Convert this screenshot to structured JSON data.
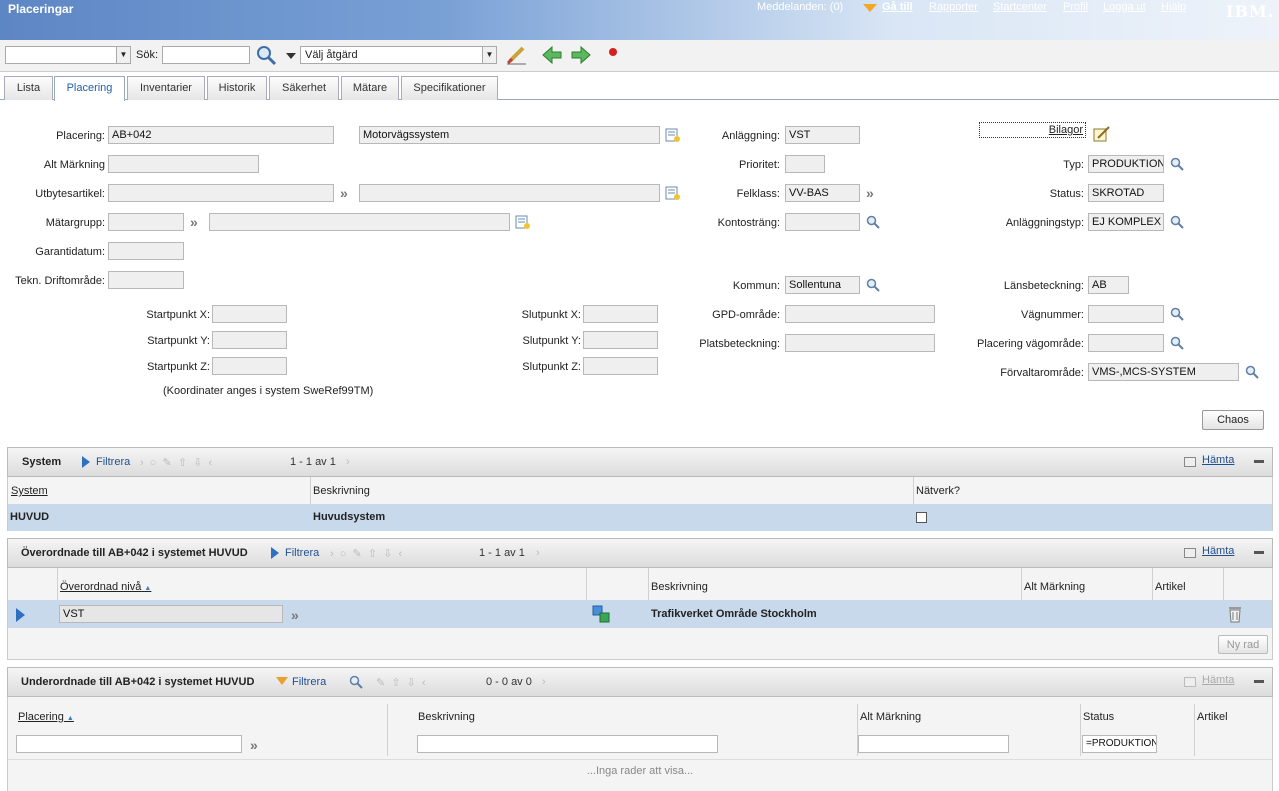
{
  "app": {
    "title": "Placeringar",
    "messages": "Meddelanden: (0)",
    "goto": "Gå till",
    "nav": [
      "Rapporter",
      "Startcenter",
      "Profil",
      "Logga ut",
      "Hjälp"
    ],
    "brand": "IBM."
  },
  "toolbar": {
    "search_label": "Sök:",
    "action_select": "Välj åtgärd",
    "query_value": "",
    "search_value": ""
  },
  "tabs": [
    "Lista",
    "Placering",
    "Inventarier",
    "Historik",
    "Säkerhet",
    "Mätare",
    "Specifikationer"
  ],
  "active_tab": "Placering",
  "form": {
    "placering_label": "Placering:",
    "placering_value": "AB+042",
    "placering_desc": "Motorvägssystem",
    "alt_markning_label": "Alt Märkning",
    "utbytesartikel_label": "Utbytesartikel:",
    "matargrupp_label": "Mätargrupp:",
    "garantidatum_label": "Garantidatum:",
    "tekn_label": "Tekn. Driftområde:",
    "startpunkt_x_label": "Startpunkt X:",
    "startpunkt_y_label": "Startpunkt Y:",
    "startpunkt_z_label": "Startpunkt Z:",
    "slutpunkt_x_label": "Slutpunkt X:",
    "slutpunkt_y_label": "Slutpunkt Y:",
    "slutpunkt_z_label": "Slutpunkt Z:",
    "coord_note": "(Koordinater anges i system SweRef99TM)",
    "anlaggning_label": "Anläggning:",
    "anlaggning_value": "VST",
    "prioritet_label": "Prioritet:",
    "felklass_label": "Felklass:",
    "felklass_value": "VV-BAS",
    "kontostrang_label": "Kontosträng:",
    "kommun_label": "Kommun:",
    "kommun_value": "Sollentuna",
    "gpd_label": "GPD-område:",
    "platsbeteckning_label": "Platsbeteckning:",
    "bilagor_label": "Bilagor",
    "typ_label": "Typ:",
    "typ_value": "PRODUKTION",
    "status_label": "Status:",
    "status_value": "SKROTAD",
    "anlaggningstyp_label": "Anläggningstyp:",
    "anlaggningstyp_value": "EJ KOMPLEX",
    "lansbeteckning_label": "Länsbeteckning:",
    "lansbeteckning_value": "AB",
    "vagnummer_label": "Vägnummer:",
    "placering_vagomrade_label": "Placering vägområde:",
    "forvaltaromrade_label": "Förvaltarområde:",
    "forvaltaromrade_value": "VMS-,MCS-SYSTEM",
    "chaos_button": "Chaos"
  },
  "system_section": {
    "title": "System",
    "filter": "Filtrera",
    "pager": "1 - 1 av 1",
    "fetch": "Hämta",
    "columns": [
      "System",
      "Beskrivning",
      "Nätverk?"
    ],
    "rows": [
      {
        "system": "HUVUD",
        "beskrivning": "Huvudsystem",
        "natverk": false
      }
    ]
  },
  "parent_section": {
    "title": "Överordnade till AB+042 i systemet HUVUD",
    "filter": "Filtrera",
    "pager": "1 - 1 av 1",
    "fetch": "Hämta",
    "columns": [
      "Överordnad nivå",
      "Beskrivning",
      "Alt Märkning",
      "Artikel"
    ],
    "rows": [
      {
        "niva": "VST",
        "beskrivning": "Trafikverket Område Stockholm",
        "alt": "",
        "artikel": ""
      }
    ],
    "new_row": "Ny rad"
  },
  "child_section": {
    "title": "Underordnade till AB+042 i systemet HUVUD",
    "filter": "Filtrera",
    "pager": "0 - 0 av 0",
    "fetch": "Hämta",
    "columns": [
      "Placering",
      "Beskrivning",
      "Alt Märkning",
      "Status",
      "Artikel"
    ],
    "filter_status": "=PRODUKTION",
    "empty": "...Inga rader att visa..."
  }
}
